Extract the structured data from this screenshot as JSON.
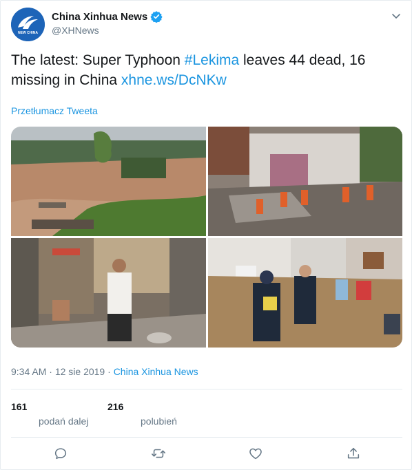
{
  "account": {
    "display_name": "China Xinhua News",
    "handle": "@XHNews",
    "verified": true,
    "avatar_text": "NEW CHINA"
  },
  "tweet": {
    "text_part1": "The latest: Super Typhoon ",
    "hashtag": "#Lekima",
    "text_part2": " leaves 44 dead, 16 missing in China ",
    "link": "xhne.ws/DcNKw",
    "translate_label": "Przetłumacz Tweeta"
  },
  "meta": {
    "time": "9:34 AM",
    "separator": " · ",
    "date": "12 sie 2019",
    "source": "China Xinhua News"
  },
  "stats": {
    "retweets_count": "161",
    "retweets_label": "podań dalej",
    "likes_count": "216",
    "likes_label": "polubień"
  },
  "actions": {
    "reply_icon": "speech-bubble",
    "retweet_icon": "retweet-arrows",
    "like_icon": "heart",
    "share_icon": "upload-arrow"
  },
  "colors": {
    "link": "#1b95e0",
    "secondary_text": "#657786",
    "border": "#e6ecf0",
    "verified": "#1da1f2",
    "avatar_bg": "#1d64b8"
  }
}
